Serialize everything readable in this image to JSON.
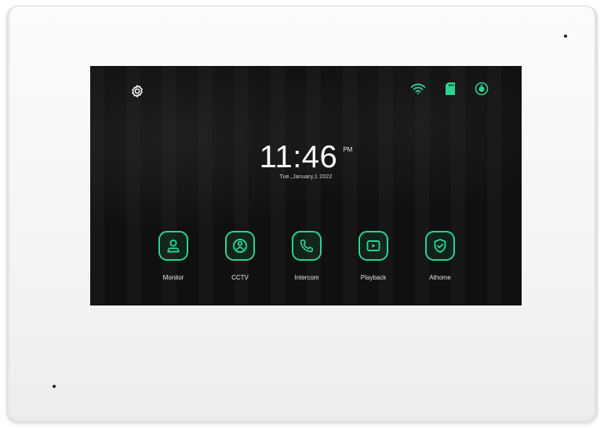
{
  "device": {
    "accent_color": "#2bd48e"
  },
  "status": {
    "wifi_icon": "wifi-icon",
    "sd_card_icon": "sd-card-icon",
    "record_icon": "record-timer-icon"
  },
  "settings": {
    "icon": "gear-icon"
  },
  "clock": {
    "time": "11:46",
    "ampm": "PM",
    "date": "Tue.,January,1 2022"
  },
  "apps": [
    {
      "label": "Monitor",
      "icon": "person-icon"
    },
    {
      "label": "CCTV",
      "icon": "camera-icon"
    },
    {
      "label": "Intercom",
      "icon": "phone-icon"
    },
    {
      "label": "Playback",
      "icon": "play-icon"
    },
    {
      "label": "Athome",
      "icon": "shield-check-icon"
    }
  ]
}
